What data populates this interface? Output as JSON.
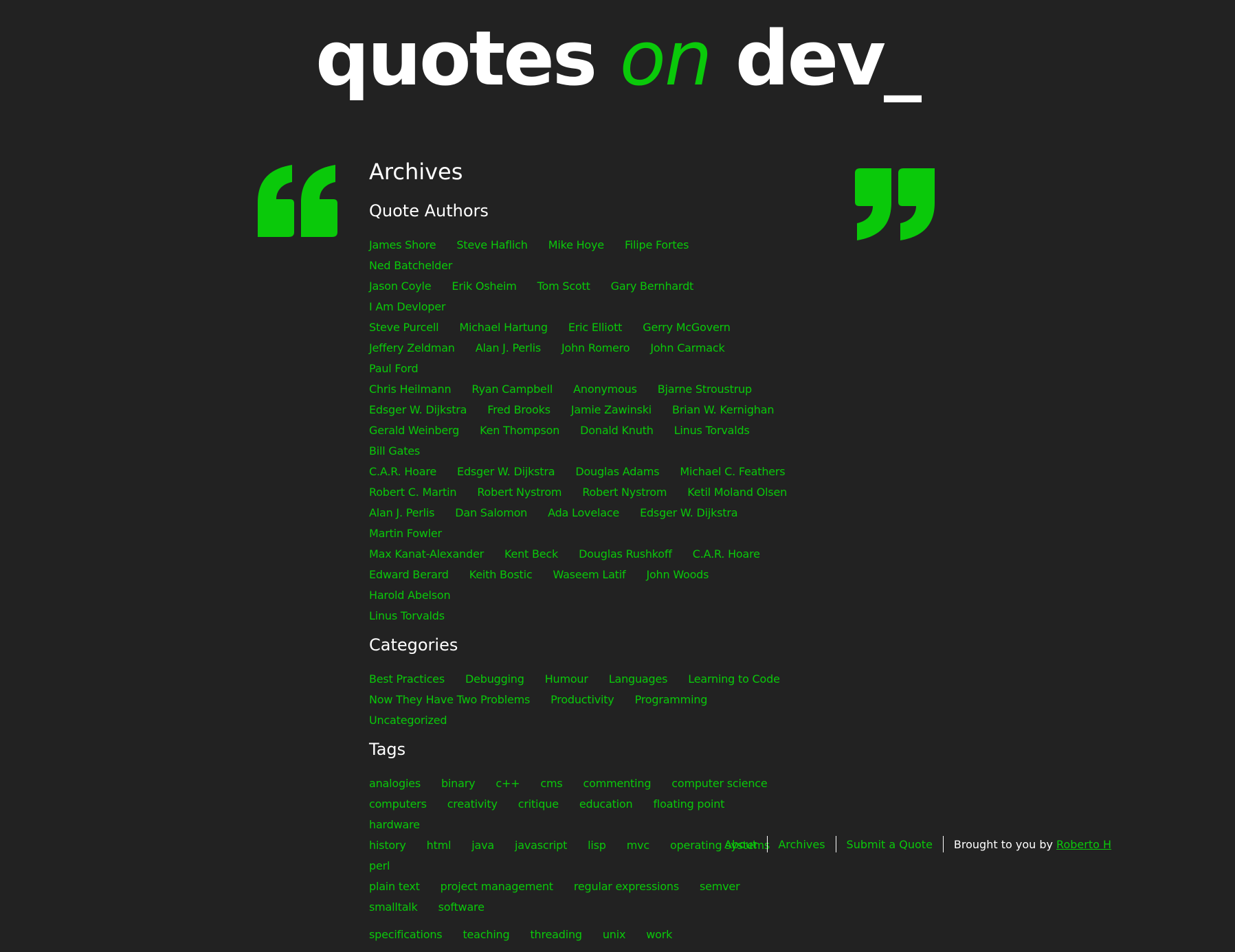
{
  "colors": {
    "background": "#222222",
    "accent": "#0ac90a",
    "text": "#ffffff"
  },
  "logo": {
    "part1": "quotes ",
    "part2": "on",
    "part3": " dev_"
  },
  "page_title": "Archives",
  "sections": {
    "authors": {
      "title": "Quote Authors",
      "items": [
        "James Shore",
        "Steve Haflich",
        "Mike Hoye",
        "Filipe Fortes",
        "Ned Batchelder",
        "Jason Coyle",
        "Erik Osheim",
        "Tom Scott",
        "Gary Bernhardt",
        "I Am Devloper",
        "Steve Purcell",
        "Michael Hartung",
        "Eric Elliott",
        "Gerry McGovern",
        "Jeffery Zeldman",
        "Alan J. Perlis",
        "John Romero",
        "John Carmack",
        "Paul Ford",
        "Chris Heilmann",
        "Ryan Campbell",
        "Anonymous",
        "Bjarne Stroustrup",
        "Edsger W. Dijkstra",
        "Fred Brooks",
        "Jamie Zawinski",
        "Brian W. Kernighan",
        "Gerald Weinberg",
        "Ken Thompson",
        "Donald Knuth",
        "Linus Torvalds",
        "Bill Gates",
        "C.A.R. Hoare",
        "Edsger W. Dijkstra",
        "Douglas Adams",
        "Michael C. Feathers",
        "Robert C. Martin",
        "Robert Nystrom",
        "Robert Nystrom",
        "Ketil Moland Olsen",
        "Alan J. Perlis",
        "Dan Salomon",
        "Ada Lovelace",
        "Edsger W. Dijkstra",
        "Martin Fowler",
        "Max Kanat-Alexander",
        "Kent Beck",
        "Douglas Rushkoff",
        "C.A.R. Hoare",
        "Edward Berard",
        "Keith Bostic",
        "Waseem Latif",
        "John Woods",
        "Harold Abelson",
        "Linus Torvalds"
      ],
      "rows": [
        5,
        5,
        4,
        5,
        4,
        4,
        5,
        4,
        4,
        5,
        4,
        5,
        1
      ]
    },
    "categories": {
      "title": "Categories",
      "items": [
        "Best Practices",
        "Debugging",
        "Humour",
        "Languages",
        "Learning to Code",
        "Now They Have Two Problems",
        "Productivity",
        "Programming",
        "Uncategorized"
      ],
      "rows": [
        5,
        4
      ]
    },
    "tags": {
      "title": "Tags",
      "items": [
        "analogies",
        "binary",
        "c++",
        "cms",
        "commenting",
        "computer science",
        "computers",
        "creativity",
        "critique",
        "education",
        "floating point",
        "hardware",
        "history",
        "html",
        "java",
        "javascript",
        "lisp",
        "mvc",
        "operating systems",
        "perl",
        "plain text",
        "project management",
        "regular expressions",
        "semver",
        "smalltalk",
        "software",
        "specifications",
        "teaching",
        "threading",
        "unix",
        "work"
      ],
      "rows": [
        6,
        6,
        8,
        6,
        7
      ]
    }
  },
  "footer": {
    "about": "About",
    "archives": "Archives",
    "submit": "Submit a Quote",
    "credit_prefix": "Brought to you by ",
    "credit_link": "Roberto H"
  }
}
